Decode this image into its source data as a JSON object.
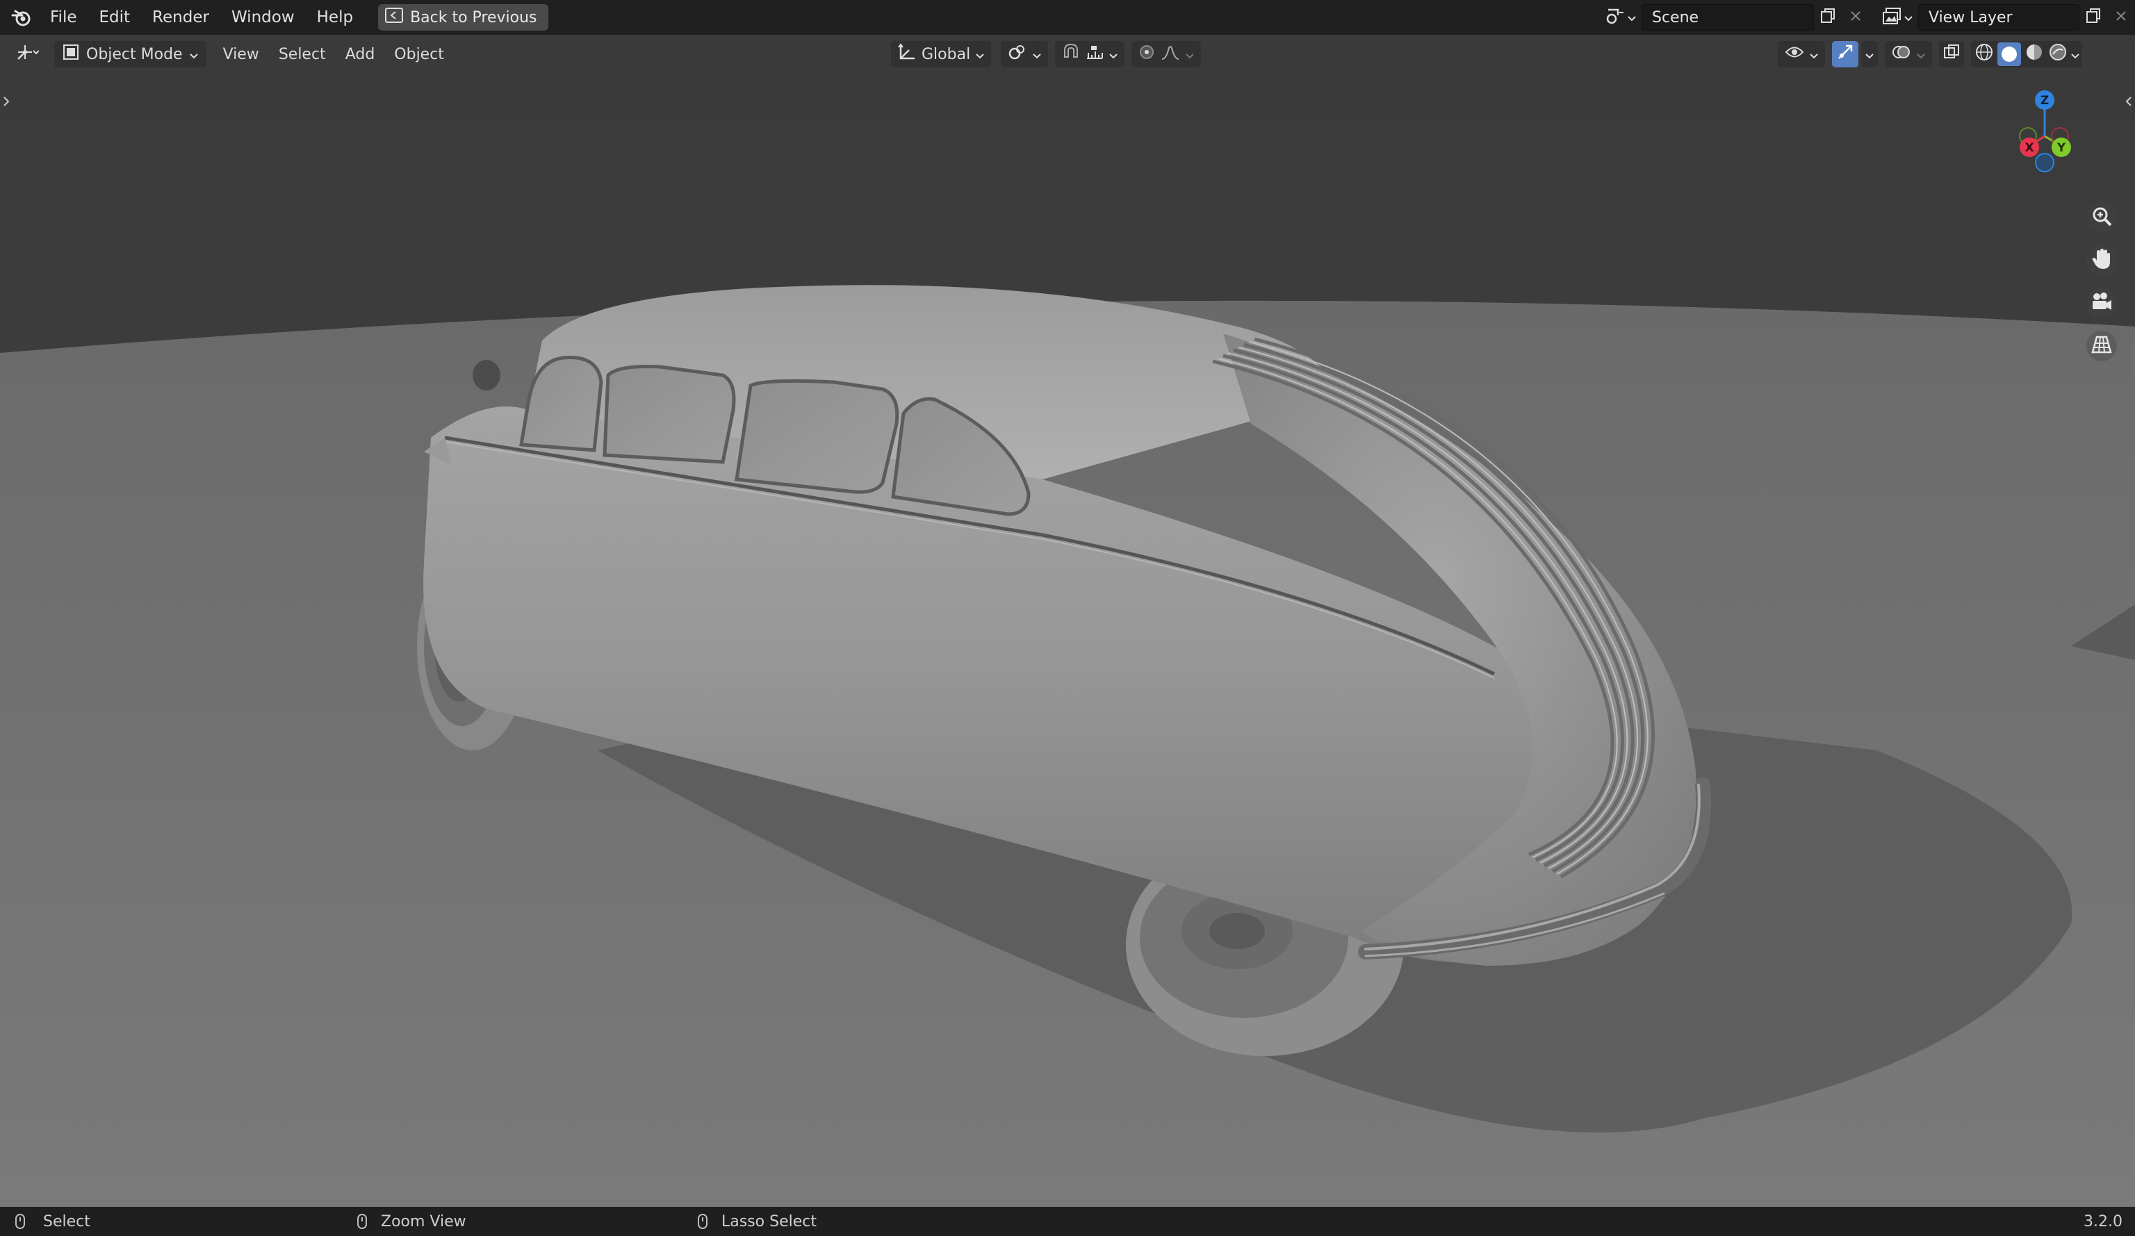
{
  "topbar": {
    "menus": [
      "File",
      "Edit",
      "Render",
      "Window",
      "Help"
    ],
    "back_label": "Back to Previous",
    "scene_name": "Scene",
    "view_layer_name": "View Layer"
  },
  "header": {
    "mode": "Object Mode",
    "menus": [
      "View",
      "Select",
      "Add",
      "Object"
    ],
    "transform_orientation": "Global"
  },
  "gizmo": {
    "z": "Z",
    "x": "X",
    "y": "Y"
  },
  "statusbar": {
    "select": "Select",
    "zoom_view": "Zoom View",
    "lasso_select": "Lasso Select",
    "version": "3.2.0"
  },
  "icons": {
    "logo": "blender-logo-icon",
    "editor_type": "editor-type-icon",
    "zoom": "zoom-icon",
    "pan": "hand-icon",
    "camera": "camera-icon",
    "perspective": "grid-icon"
  },
  "colors": {
    "axis_x": "#e8364f",
    "axis_y": "#7fcb2b",
    "axis_z": "#2f83e0",
    "active": "#5680c2"
  }
}
